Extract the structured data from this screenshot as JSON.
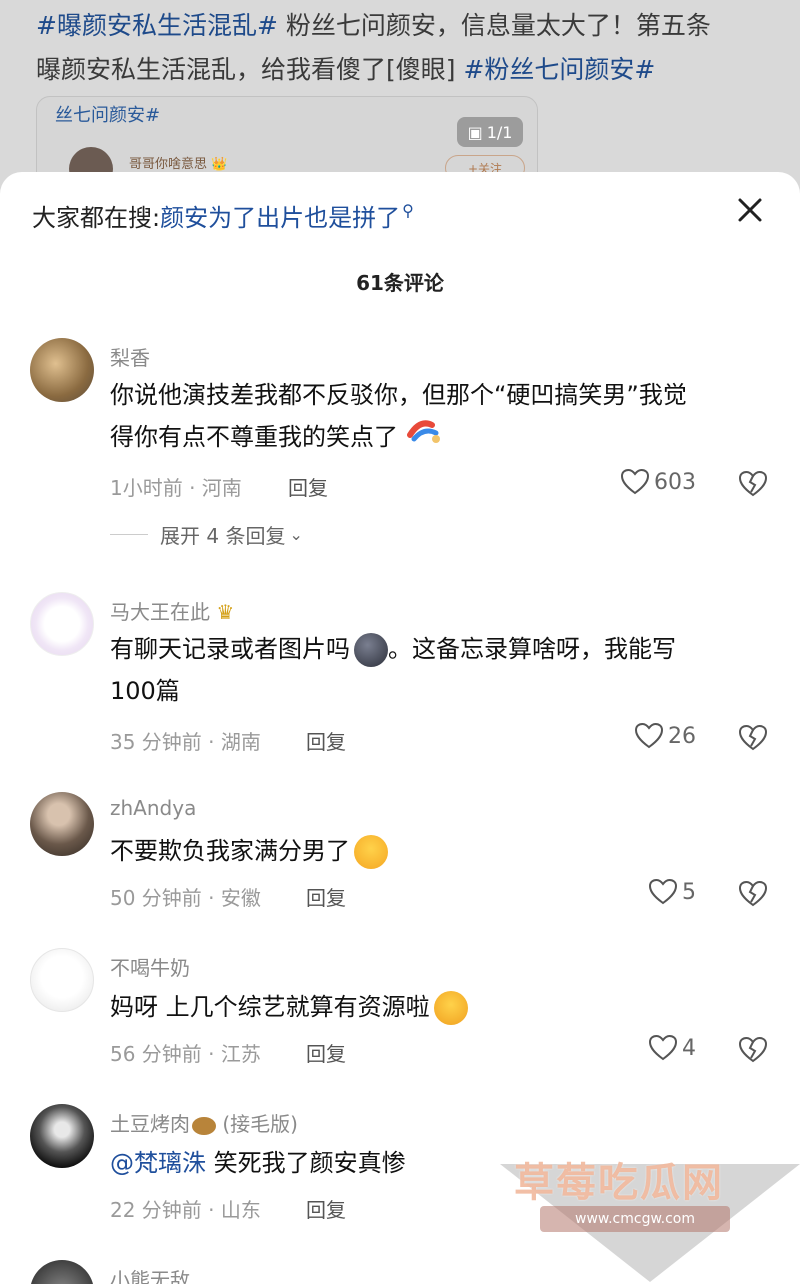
{
  "post": {
    "tag1": "#曝颜安私生活混乱#",
    "text1": " 粉丝七问颜安，信息量太大了！第五条",
    "text2": "曝颜安私生活混乱，给我看傻了[傻眼] ",
    "tag2": "#粉丝七问颜安#",
    "card_tag": "丝七问颜安#",
    "card_page": "1/1",
    "card_author": "哥哥你啥意思 👑",
    "card_follow": "+关注"
  },
  "sheet": {
    "search_prefix": "大家都在搜:",
    "search_query": "颜安为了出片也是拼了",
    "count_title": "61条评论"
  },
  "comments": [
    {
      "nick": "梨香",
      "line1": "你说他演技差我都不反驳你，但那个“硬凹搞笑男”我觉",
      "line2": "得你有点不尊重我的笑点了",
      "meta": "1小时前 · 河南",
      "reply": "回复",
      "likes": "603",
      "expand": "展开 4 条回复"
    },
    {
      "nick": "马大王在此",
      "line1": "有聊天记录或者图片吗",
      "line1b": "。这备忘录算啥呀，我能写",
      "line2": "100篇",
      "meta": "35 分钟前 · 湖南",
      "reply": "回复",
      "likes": "26"
    },
    {
      "nick": "zhAndya",
      "line1": "不要欺负我家满分男了",
      "meta": "50 分钟前 · 安徽",
      "reply": "回复",
      "likes": "5"
    },
    {
      "nick": "不喝牛奶",
      "line1": "妈呀 上几个综艺就算有资源啦",
      "meta": "56 分钟前 · 江苏",
      "reply": "回复",
      "likes": "4"
    },
    {
      "nick": "土豆烤肉",
      "nick_suffix": " (接毛版)",
      "mention": "@梵璃洙",
      "line1": " 笑死我了颜安真惨",
      "meta": "22 分钟前 · 山东",
      "reply": "回复"
    },
    {
      "nick": "小熊无敌"
    }
  ],
  "watermark": {
    "title": "草莓吃瓜网",
    "url": "www.cmcgw.com"
  }
}
